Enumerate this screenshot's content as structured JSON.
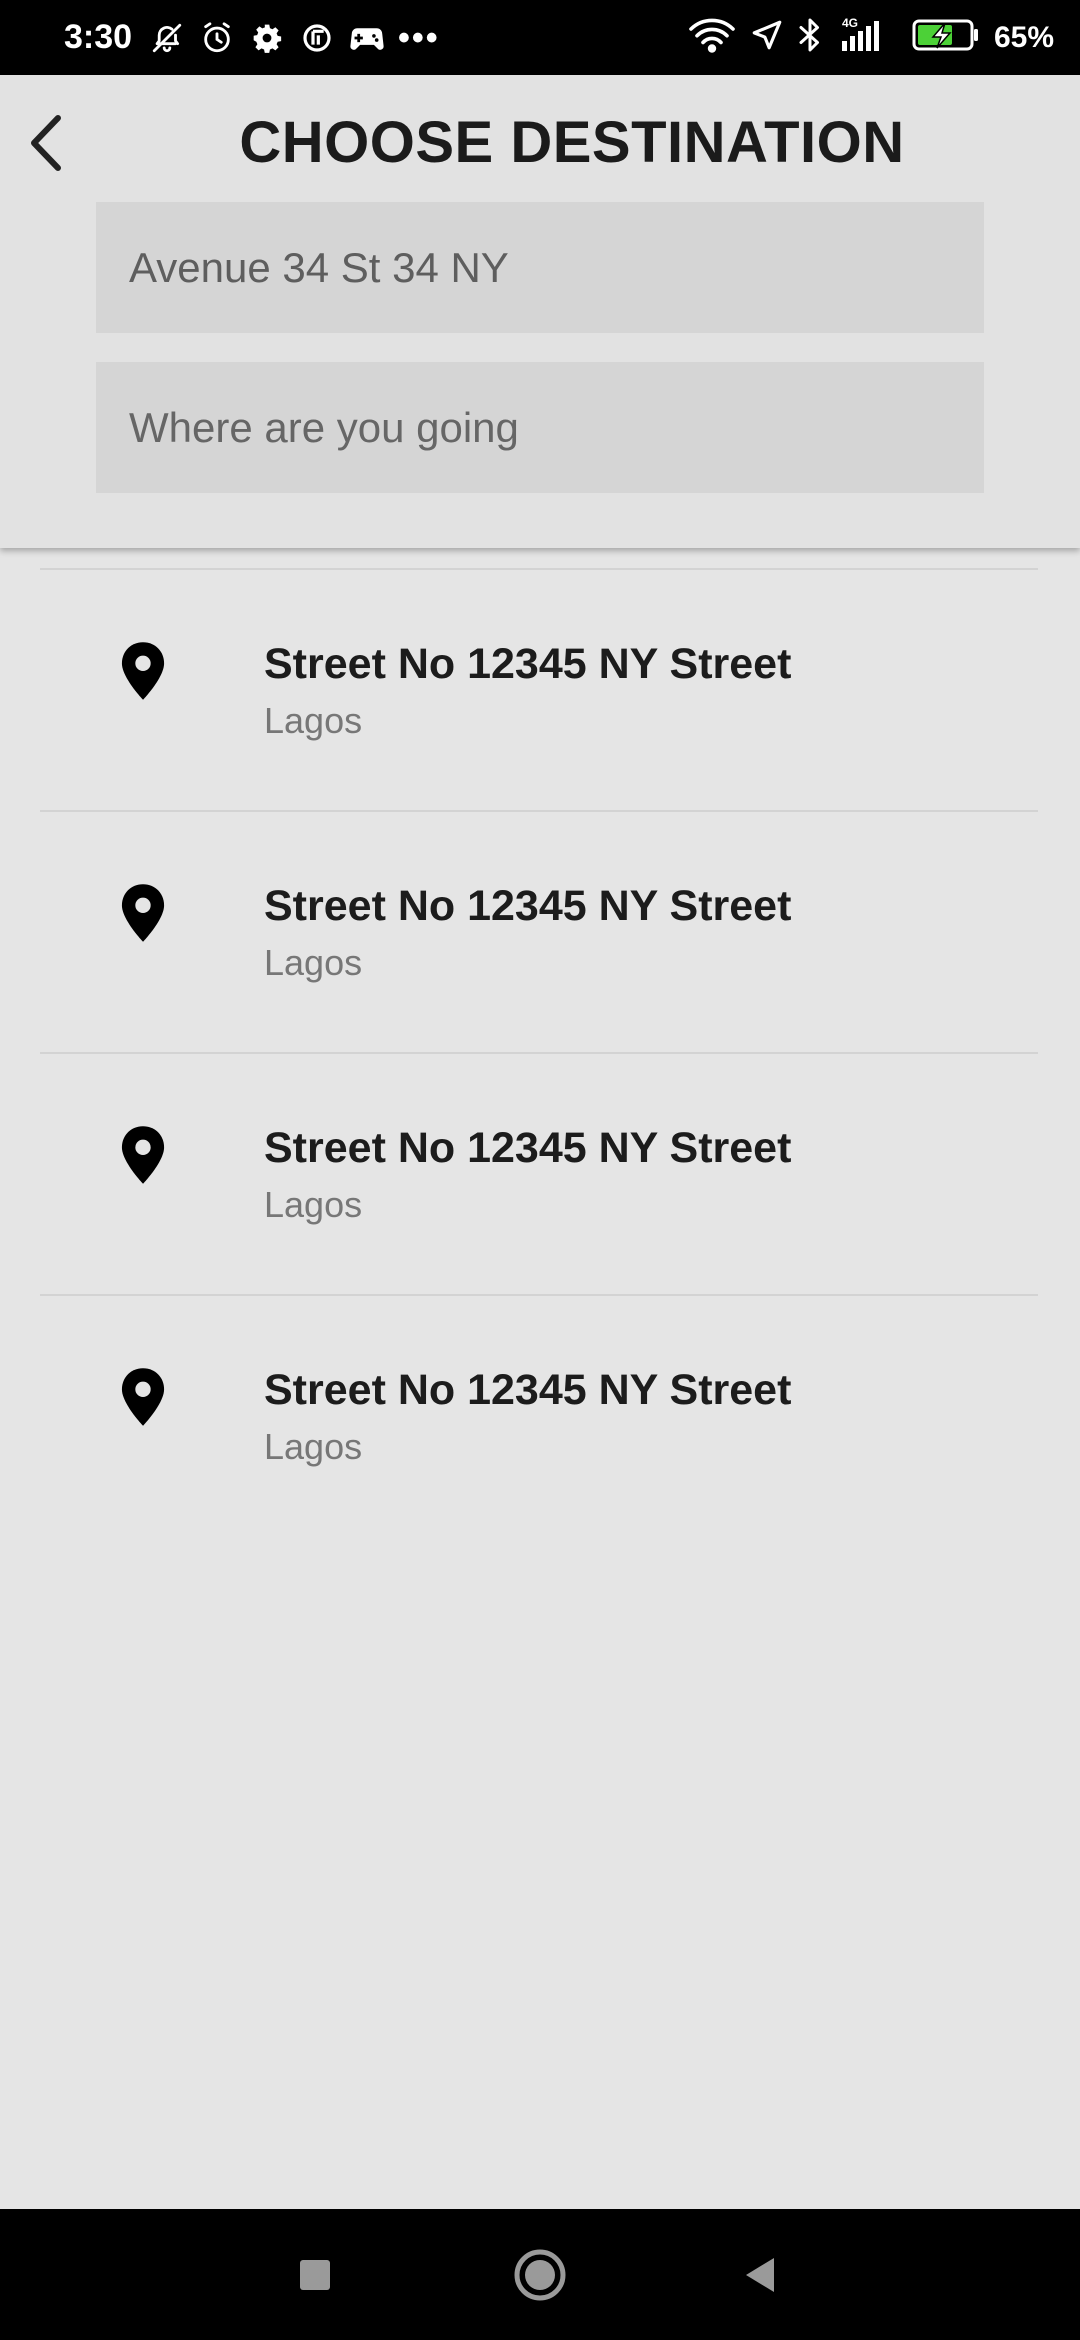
{
  "status_bar": {
    "time": "3:30",
    "overflow": "•••",
    "battery_percent": "65%",
    "network_label": "4G",
    "icons": [
      "bell-off-icon",
      "alarm-icon",
      "gear-icon",
      "news-icon",
      "game-icon",
      "wifi-icon",
      "location-icon",
      "bluetooth-icon",
      "signal-icon",
      "battery-charging-icon"
    ]
  },
  "header": {
    "title": "CHOOSE DESTINATION",
    "back_icon": "chevron-left-icon"
  },
  "origin_input": {
    "value": "Avenue 34 St 34 NY",
    "placeholder": ""
  },
  "destination_input": {
    "value": "",
    "placeholder": "Where are you going"
  },
  "suggestions": [
    {
      "title": "Street No 12345 NY Street",
      "subtitle": "Lagos",
      "icon": "map-pin-icon"
    },
    {
      "title": "Street No 12345 NY Street",
      "subtitle": "Lagos",
      "icon": "map-pin-icon"
    },
    {
      "title": "Street No 12345 NY Street",
      "subtitle": "Lagos",
      "icon": "map-pin-icon"
    },
    {
      "title": "Street No 12345 NY Street",
      "subtitle": "Lagos",
      "icon": "map-pin-icon"
    }
  ],
  "nav_bar": {
    "buttons": [
      "recents-icon",
      "home-icon",
      "back-icon"
    ]
  },
  "colors": {
    "background": "#e5e5e5",
    "header_background": "#e2e2e2",
    "field_background": "#d5d5d5",
    "title_text": "#1b1b1b",
    "secondary_text": "#777777",
    "system_bars": "#000000"
  }
}
